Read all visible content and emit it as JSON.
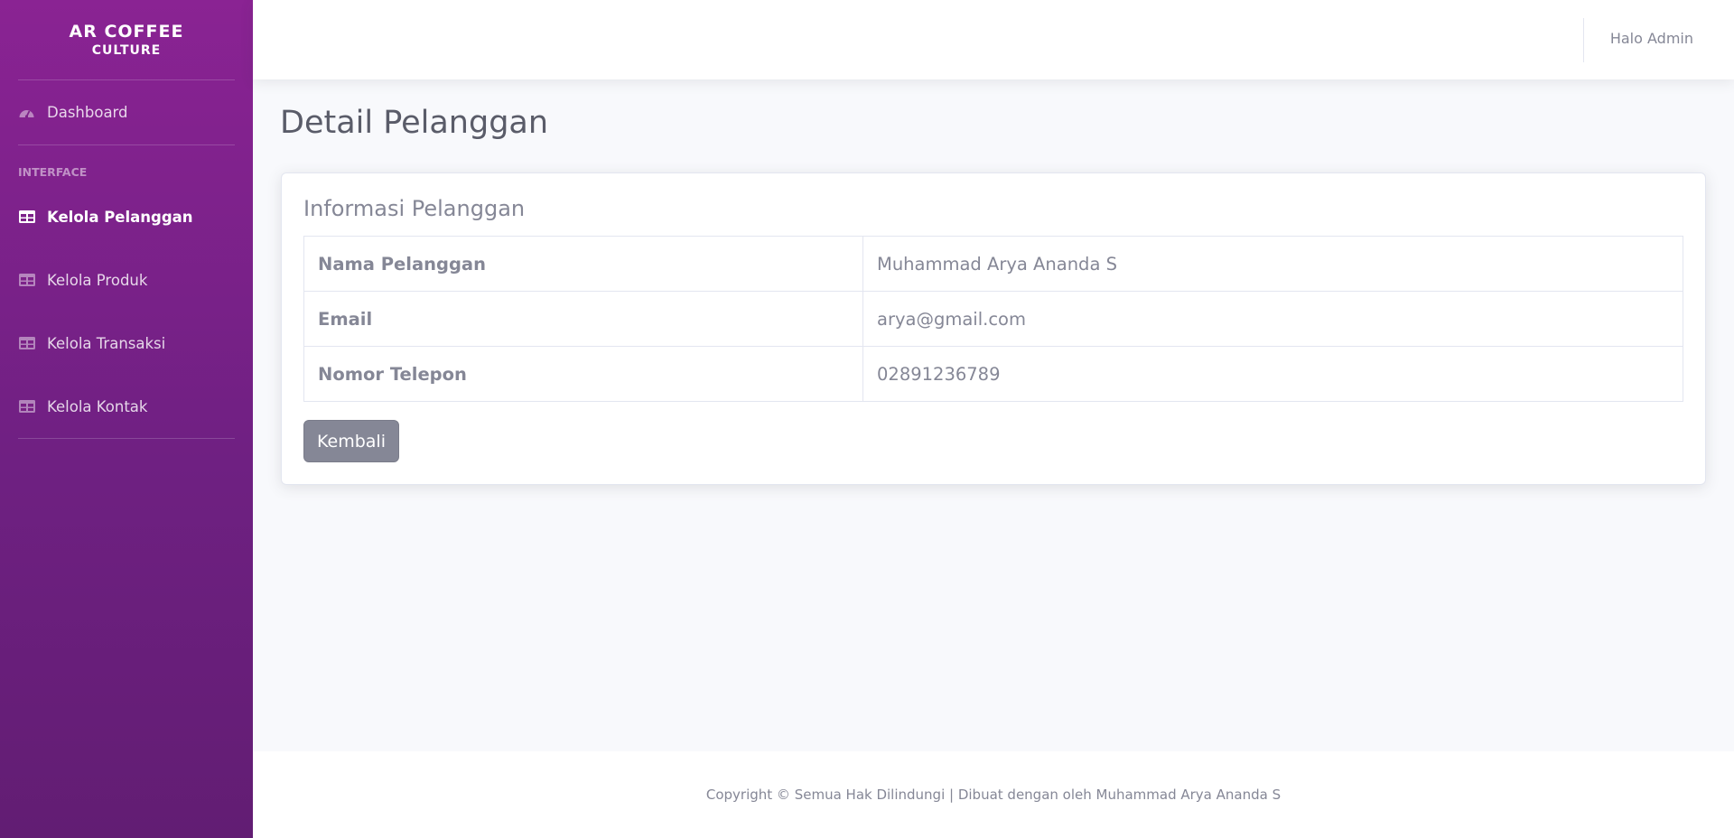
{
  "sidebar": {
    "brand_line1": "AR COFFEE",
    "brand_line2": "CULTURE",
    "dashboard_label": "Dashboard",
    "section_heading": "INTERFACE",
    "items": [
      {
        "label": "Kelola Pelanggan",
        "icon": "table-icon",
        "active": true
      },
      {
        "label": "Kelola Produk",
        "icon": "table-icon",
        "active": false
      },
      {
        "label": "Kelola Transaksi",
        "icon": "table-icon",
        "active": false
      },
      {
        "label": "Kelola Kontak",
        "icon": "table-icon",
        "active": false
      }
    ]
  },
  "topbar": {
    "user_greeting": "Halo Admin"
  },
  "page": {
    "title": "Detail Pelanggan"
  },
  "card": {
    "title": "Informasi Pelanggan",
    "rows": [
      {
        "label": "Nama Pelanggan",
        "value": "Muhammad Arya Ananda S"
      },
      {
        "label": "Email",
        "value": "arya@gmail.com"
      },
      {
        "label": "Nomor Telepon",
        "value": "02891236789"
      }
    ],
    "back_button": "Kembali"
  },
  "footer": {
    "text": "Copyright © Semua Hak Dilindungi | Dibuat dengan oleh Muhammad Arya Ananda S"
  },
  "colors": {
    "sidebar_top": "#8a2393",
    "sidebar_bottom": "#621d73",
    "text_muted": "#858796",
    "title": "#5a5c69",
    "button": "#858796"
  }
}
